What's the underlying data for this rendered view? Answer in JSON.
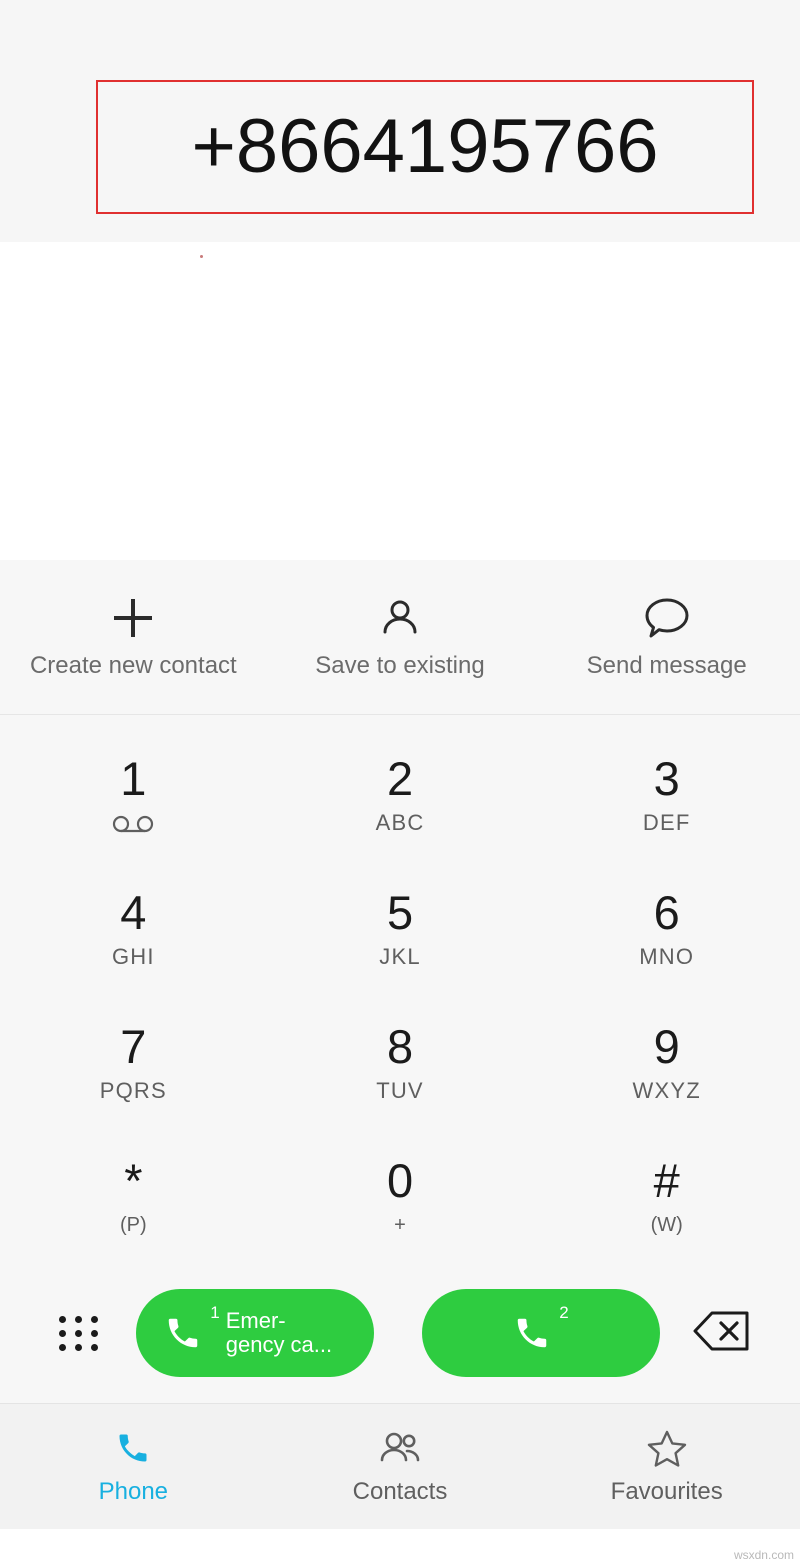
{
  "dialer": {
    "number": "+8664195766",
    "number_box_accent": "#e03030"
  },
  "actions": [
    {
      "label": "Create new contact",
      "icon": "plus-icon"
    },
    {
      "label": "Save to existing",
      "icon": "person-icon"
    },
    {
      "label": "Send message",
      "icon": "message-bubble-icon"
    }
  ],
  "keypad": {
    "keys": [
      {
        "digit": "1",
        "sub": "",
        "icon": "voicemail-icon"
      },
      {
        "digit": "2",
        "sub": "ABC",
        "icon": ""
      },
      {
        "digit": "3",
        "sub": "DEF",
        "icon": ""
      },
      {
        "digit": "4",
        "sub": "GHI",
        "icon": ""
      },
      {
        "digit": "5",
        "sub": "JKL",
        "icon": ""
      },
      {
        "digit": "6",
        "sub": "MNO",
        "icon": ""
      },
      {
        "digit": "7",
        "sub": "PQRS",
        "icon": ""
      },
      {
        "digit": "8",
        "sub": "TUV",
        "icon": ""
      },
      {
        "digit": "9",
        "sub": "WXYZ",
        "icon": ""
      },
      {
        "digit": "*",
        "sub": "(P)",
        "icon": ""
      },
      {
        "digit": "0",
        "sub": "+",
        "icon": ""
      },
      {
        "digit": "#",
        "sub": "(W)",
        "icon": ""
      }
    ]
  },
  "callbar": {
    "keypad_toggle_icon": "dots-grid-icon",
    "call_sim1": {
      "badge": "1",
      "label": "Emer-\ngency ca...",
      "color": "#2ecc40"
    },
    "call_sim2": {
      "badge": "2",
      "label": "",
      "color": "#2ecc40"
    },
    "backspace_icon": "backspace-icon"
  },
  "bottom_nav": {
    "active_color": "#18b0e0",
    "items": [
      {
        "label": "Phone",
        "icon": "phone-icon",
        "active": true
      },
      {
        "label": "Contacts",
        "icon": "contacts-icon",
        "active": false
      },
      {
        "label": "Favourites",
        "icon": "star-icon",
        "active": false
      }
    ]
  },
  "watermark": "wsxdn.com"
}
